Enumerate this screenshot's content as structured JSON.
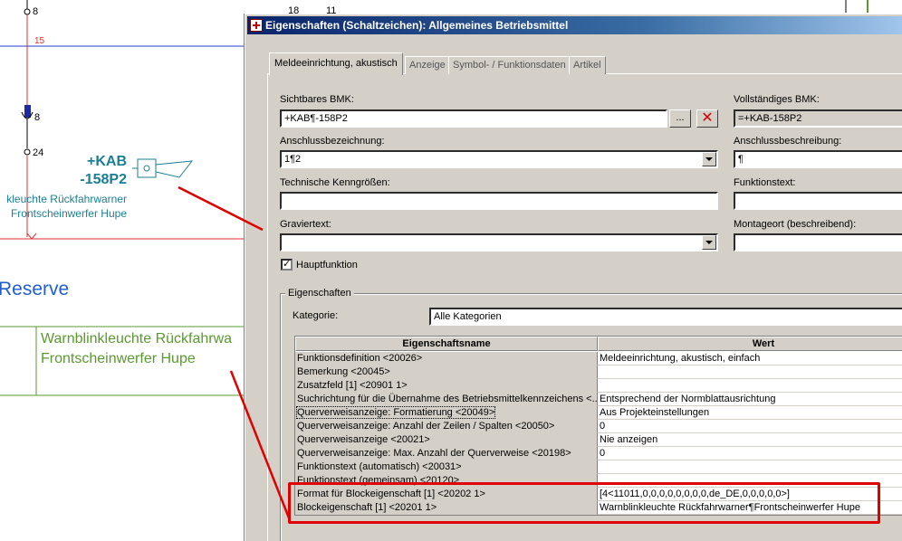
{
  "schematic": {
    "pins": [
      "8",
      "15",
      "8",
      "24",
      "18",
      "11"
    ],
    "bmk_line1": "+KAB",
    "bmk_line2": "-158P2",
    "func_line1": "kleuchte Rückfahrwarner",
    "func_line2": "Frontscheinwerfer Hupe",
    "reserve": "Reserve",
    "green_line1": "Warnblinkleuchte Rückfahrwa",
    "green_line2": "Frontscheinwerfer Hupe"
  },
  "dialog": {
    "title": "Eigenschaften (Schaltzeichen): Allgemeines Betriebsmittel",
    "tabs": [
      "Meldeeinrichtung, akustisch",
      "Anzeige",
      "Symbol- / Funktionsdaten",
      "Artikel"
    ],
    "fields": {
      "sichtbares_bmk_label": "Sichtbares BMK:",
      "sichtbares_bmk_value": "+KAB¶-158P2",
      "browse_label": "...",
      "delete_label": "✕",
      "vollstaendiges_bmk_label": "Vollständiges BMK:",
      "vollstaendiges_bmk_value": "=+KAB-158P2",
      "anschluss_label": "Anschlussbezeichnung:",
      "anschluss_value": "1¶2",
      "anschluss_beschr_label": "Anschlussbeschreibung:",
      "anschluss_beschr_value": "¶",
      "tech_label": "Technische Kenngrößen:",
      "tech_value": "",
      "funktionstext_label": "Funktionstext:",
      "funktionstext_value": "",
      "gravier_label": "Graviertext:",
      "gravier_value": "",
      "montage_label": "Montageort (beschreibend):",
      "montage_value": "",
      "hauptfunktion_label": "Hauptfunktion",
      "hauptfunktion_checked": "✓"
    },
    "group": {
      "title": "Eigenschaften",
      "kategorie_label": "Kategorie:",
      "kategorie_value": "Alle Kategorien"
    },
    "grid": {
      "col_name": "Eigenschaftsname",
      "col_value": "Wert",
      "rows": [
        {
          "name": "Funktionsdefinition <20026>",
          "value": "Meldeeinrichtung, akustisch, einfach"
        },
        {
          "name": "Bemerkung <20045>",
          "value": ""
        },
        {
          "name": "Zusatzfeld [1] <20901 1>",
          "value": ""
        },
        {
          "name": "Suchrichtung für die Übernahme des Betriebsmittelkennzeichens <...",
          "value": "Entsprechend der Normblattausrichtung"
        },
        {
          "name": "Querverweisanzeige: Formatierung <20049>",
          "value": "Aus Projekteinstellungen"
        },
        {
          "name": "Querverweisanzeige: Anzahl der Zeilen / Spalten <20050>",
          "value": "0"
        },
        {
          "name": "Querverweisanzeige <20021>",
          "value": "Nie anzeigen"
        },
        {
          "name": "Querverweisanzeige: Max. Anzahl der Querverweise <20198>",
          "value": "0"
        },
        {
          "name": "Funktionstext (automatisch) <20031>",
          "value": ""
        },
        {
          "name": "Funktionstext (gemeinsam) <20120>",
          "value": ""
        },
        {
          "name": "Format für Blockeigenschaft [1] <20202 1>",
          "value": "[4<11011,0,0,0,0,0,0,0,0,de_DE,0,0,0,0,0>]"
        },
        {
          "name": "Blockeigenschaft [1] <20201 1>",
          "value": "Warnblinkleuchte Rückfahrwarner¶Frontscheinwerfer Hupe"
        }
      ]
    }
  },
  "colors": {
    "annotation_red": "#e00000",
    "wire_red": "#e03030",
    "wire_blue": "#2040d0",
    "bmk_teal": "#1a7f95",
    "green_text": "#5a9a2f"
  }
}
